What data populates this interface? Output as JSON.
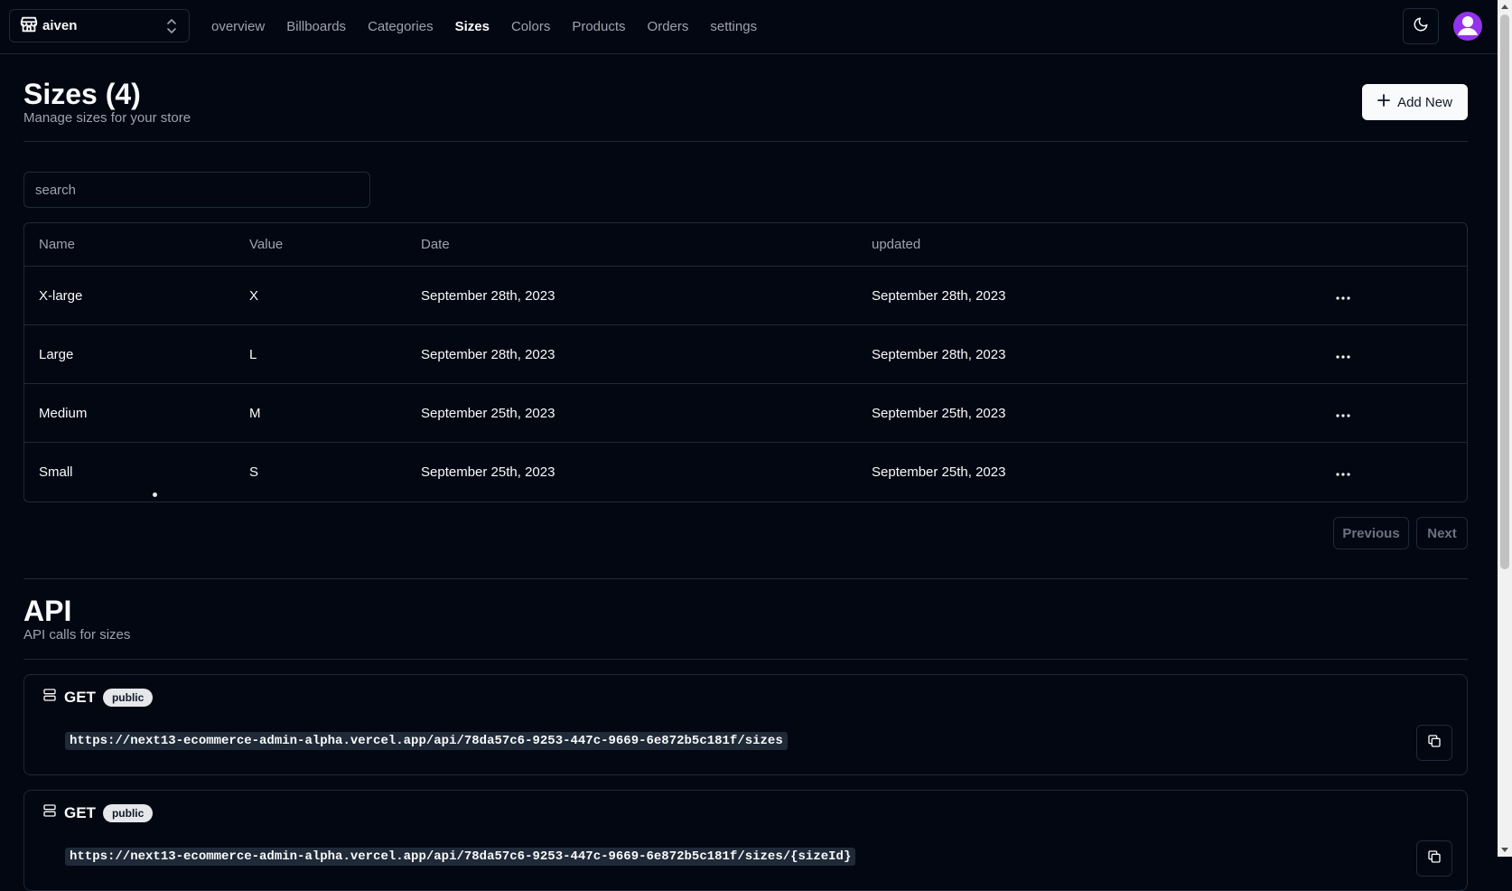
{
  "topbar": {
    "store_name": "aiven",
    "nav": [
      {
        "label": "overview",
        "active": false
      },
      {
        "label": "Billboards",
        "active": false
      },
      {
        "label": "Categories",
        "active": false
      },
      {
        "label": "Sizes",
        "active": true
      },
      {
        "label": "Colors",
        "active": false
      },
      {
        "label": "Products",
        "active": false
      },
      {
        "label": "Orders",
        "active": false
      },
      {
        "label": "settings",
        "active": false
      }
    ],
    "icons": {
      "store": "store-icon",
      "switcher": "chevrons-up-down-icon",
      "theme": "moon-icon",
      "avatar": "user-icon"
    }
  },
  "heading": {
    "title": "Sizes (4)",
    "description": "Manage sizes for your store",
    "add_label": "Add New"
  },
  "search": {
    "placeholder": "search",
    "value": ""
  },
  "table": {
    "columns": [
      "Name",
      "Value",
      "Date",
      "updated"
    ],
    "rows": [
      {
        "name": "X-large",
        "value": "X",
        "date": "September 28th, 2023",
        "updated": "September 28th, 2023"
      },
      {
        "name": "Large",
        "value": "L",
        "date": "September 28th, 2023",
        "updated": "September 28th, 2023"
      },
      {
        "name": "Medium",
        "value": "M",
        "date": "September 25th, 2023",
        "updated": "September 25th, 2023"
      },
      {
        "name": "Small",
        "value": "S",
        "date": "September 25th, 2023",
        "updated": "September 25th, 2023"
      }
    ],
    "action_icon": "more-horizontal-icon"
  },
  "pagination": {
    "previous": "Previous",
    "next": "Next"
  },
  "api": {
    "title": "API",
    "description": "API calls for sizes",
    "calls": [
      {
        "method": "GET",
        "badge": "public",
        "url": "https://next13-ecommerce-admin-alpha.vercel.app/api/78da57c6-9253-447c-9669-6e872b5c181f/sizes"
      },
      {
        "method": "GET",
        "badge": "public",
        "url": "https://next13-ecommerce-admin-alpha.vercel.app/api/78da57c6-9253-447c-9669-6e872b5c181f/sizes/{sizeId}"
      }
    ]
  },
  "colors": {
    "background": "#030712",
    "border": "#1f2937",
    "muted": "#9ca3af",
    "avatar": "#9333ea"
  }
}
